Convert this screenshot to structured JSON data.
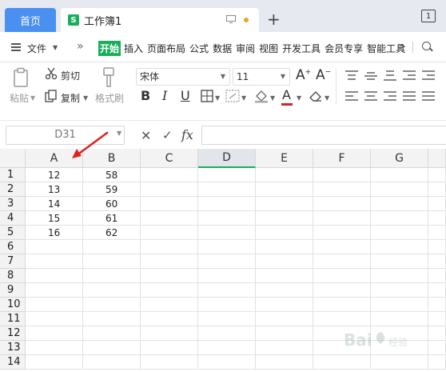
{
  "titlebar": {
    "home_tab": "首页",
    "doc_badge": "S",
    "doc_name": "工作簿1",
    "page_indicator": "1"
  },
  "menubar": {
    "file_label": "文件",
    "tabs": [
      "开始",
      "插入",
      "页面布局",
      "公式",
      "数据",
      "审阅",
      "视图",
      "开发工具",
      "会员专享",
      "智能工具"
    ],
    "active_tab": "开始"
  },
  "toolbar": {
    "paste_label": "粘贴",
    "cut_label": "剪切",
    "copy_label": "复制",
    "format_painter_label": "格式刷",
    "font_name": "宋体",
    "font_size": "11",
    "grow_font": "A",
    "shrink_font": "A",
    "bold": "B",
    "italic": "I",
    "underline": "U"
  },
  "formulabar": {
    "name_box": "D31",
    "fx_label": "fx",
    "formula_value": ""
  },
  "sheet": {
    "columns": [
      "A",
      "B",
      "C",
      "D",
      "E",
      "F",
      "G"
    ],
    "selected_column": "D",
    "rows": [
      "1",
      "2",
      "3",
      "4",
      "5",
      "6",
      "7",
      "8",
      "9",
      "10",
      "11",
      "12",
      "13",
      "14"
    ],
    "data": [
      [
        "12",
        "58"
      ],
      [
        "13",
        "59"
      ],
      [
        "14",
        "60"
      ],
      [
        "15",
        "61"
      ],
      [
        "16",
        "62"
      ]
    ]
  },
  "colors": {
    "accent_green": "#1aae5c",
    "home_tab_blue": "#4a90f0",
    "arrow_red": "#e02020"
  }
}
